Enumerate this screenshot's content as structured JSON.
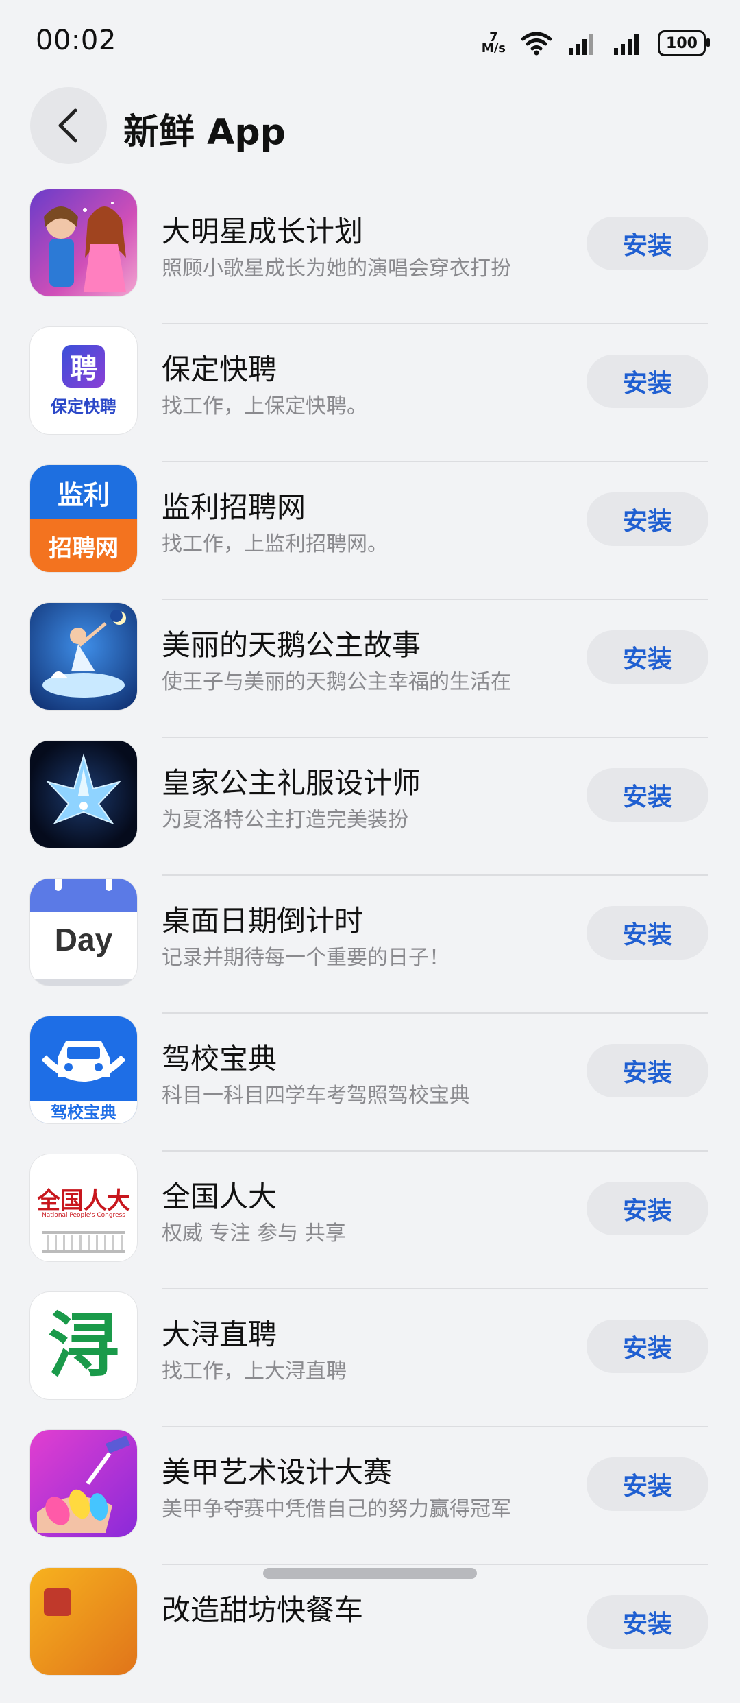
{
  "status": {
    "time": "00:02",
    "net_speed_value": "7",
    "net_speed_unit": "M/s",
    "battery": "100"
  },
  "header": {
    "title": "新鲜 App"
  },
  "apps": [
    {
      "name": "大明星成长计划",
      "desc": "照顾小歌星成长为她的演唱会穿衣打扮",
      "action": "安装"
    },
    {
      "name": "保定快聘",
      "desc": "找工作，上保定快聘。",
      "action": "安装",
      "icon_text_top": "聘",
      "icon_text_bottom": "保定快聘"
    },
    {
      "name": "监利招聘网",
      "desc": "找工作，上监利招聘网。",
      "action": "安装",
      "icon_text_top": "监利",
      "icon_text_bottom": "招聘网"
    },
    {
      "name": "美丽的天鹅公主故事",
      "desc": "使王子与美丽的天鹅公主幸福的生活在",
      "action": "安装"
    },
    {
      "name": "皇家公主礼服设计师",
      "desc": "为夏洛特公主打造完美装扮",
      "action": "安装"
    },
    {
      "name": "桌面日期倒计时",
      "desc": "记录并期待每一个重要的日子！",
      "action": "安装",
      "icon_text": "Day"
    },
    {
      "name": "驾校宝典",
      "desc": "科目一科目四学车考驾照驾校宝典",
      "action": "安装",
      "icon_text": "驾校宝典"
    },
    {
      "name": "全国人大",
      "desc": "权威 专注 参与 共享",
      "action": "安装",
      "icon_text": "全国人大",
      "icon_subtext": "National People's Congress"
    },
    {
      "name": "大浔直聘",
      "desc": "找工作，上大浔直聘",
      "action": "安装",
      "icon_text": "浔"
    },
    {
      "name": "美甲艺术设计大赛",
      "desc": "美甲争夺赛中凭借自己的努力赢得冠军",
      "action": "安装"
    },
    {
      "name": "改造甜坊快餐车",
      "desc": "",
      "action": "安装"
    }
  ],
  "colors": {
    "accent": "#1f5fd1",
    "background": "#f2f3f5",
    "button_bg": "#e6e7ea"
  }
}
